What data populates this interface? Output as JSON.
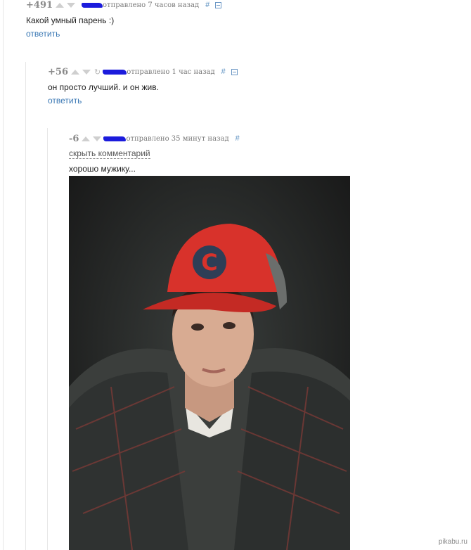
{
  "comments": [
    {
      "rating": "+491",
      "time": "отправлено 7 часов назад",
      "hash": "#",
      "text": "Какой умный парень :)",
      "reply": "ответить"
    },
    {
      "rating": "+56",
      "time": "отправлено 1 час назад",
      "hash": "#",
      "text": "он просто лучший. и он жив.",
      "reply": "ответить"
    },
    {
      "rating": "-6",
      "time": "отправлено 35 минут назад",
      "hash": "#",
      "hide_label": "скрыть комментарий",
      "text": "хорошо мужику..."
    }
  ],
  "photo": {
    "description_icon": "portrait-photo",
    "cap_logo": "C",
    "cap_color": "#d8322b"
  },
  "watermark": "pikabu.ru",
  "colors": {
    "link": "#3a78b4",
    "nick_scribble": "#1b1bdc",
    "vote_arrow": "#cfcfcf"
  }
}
